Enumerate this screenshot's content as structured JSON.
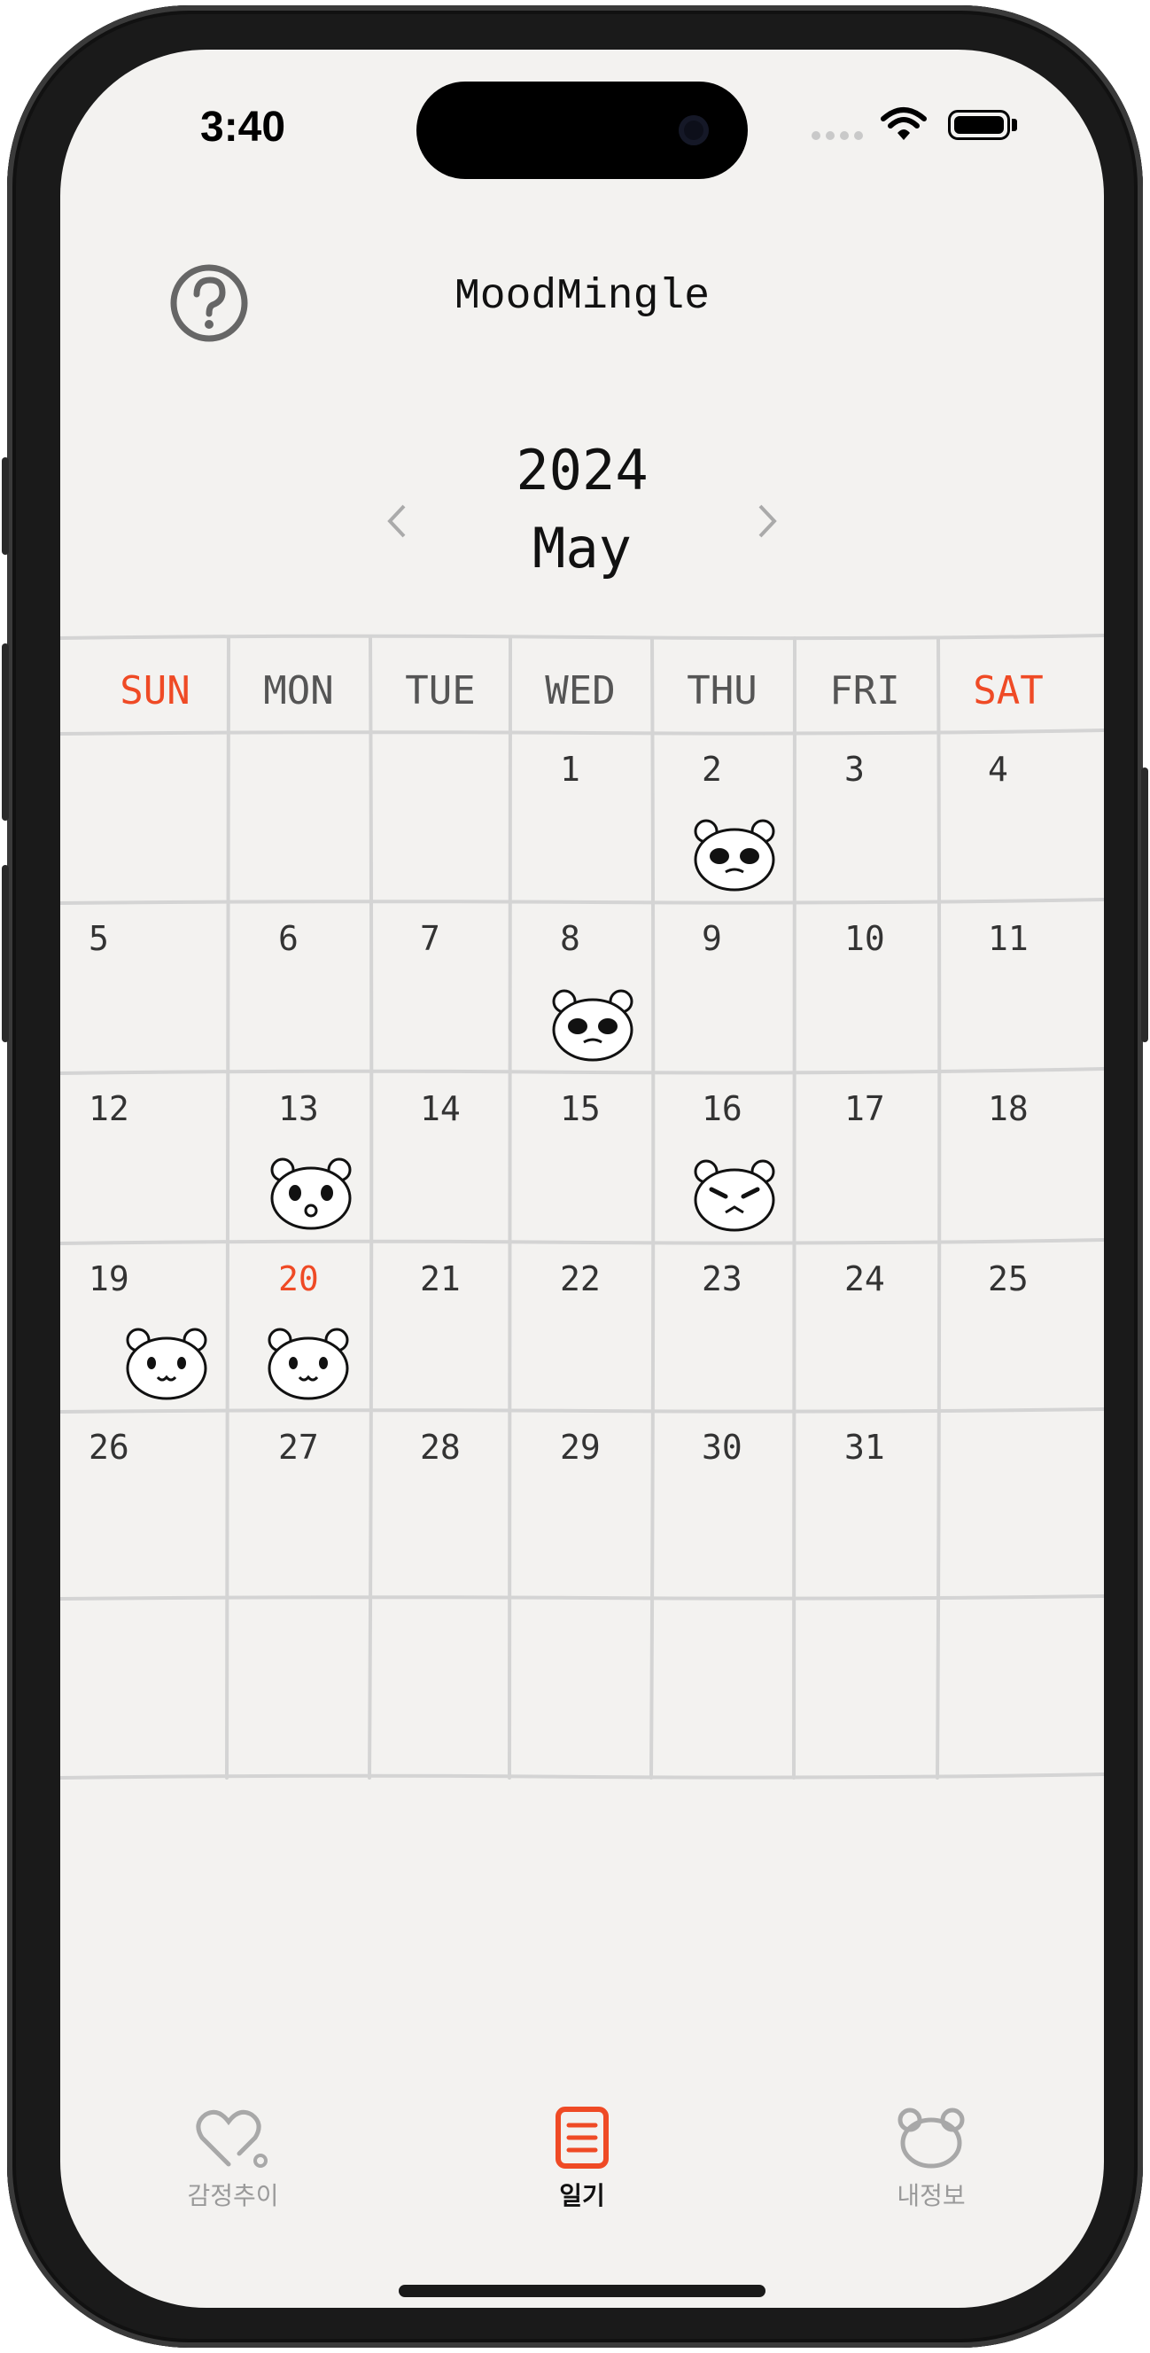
{
  "status": {
    "time": "3:40"
  },
  "header": {
    "title": "MoodMingle"
  },
  "calendar": {
    "year": "2024",
    "month": "May",
    "weekdays": [
      "SUN",
      "MON",
      "TUE",
      "WED",
      "THU",
      "FRI",
      "SAT"
    ],
    "weeks": [
      [
        "",
        "",
        "",
        "1",
        "2",
        "3",
        "4"
      ],
      [
        "5",
        "6",
        "7",
        "8",
        "9",
        "10",
        "11"
      ],
      [
        "12",
        "13",
        "14",
        "15",
        "16",
        "17",
        "18"
      ],
      [
        "19",
        "20",
        "21",
        "22",
        "23",
        "24",
        "25"
      ],
      [
        "26",
        "27",
        "28",
        "29",
        "30",
        "31",
        ""
      ],
      [
        "",
        "",
        "",
        "",
        "",
        "",
        ""
      ]
    ],
    "today": "20",
    "mood_entries": [
      {
        "day": "2",
        "mood": "crying-bear"
      },
      {
        "day": "8",
        "mood": "crying-bear"
      },
      {
        "day": "13",
        "mood": "surprised-bear"
      },
      {
        "day": "16",
        "mood": "angry-bear"
      },
      {
        "day": "19",
        "mood": "happy-bear"
      },
      {
        "day": "20",
        "mood": "happy-bear"
      }
    ]
  },
  "tabs": [
    {
      "label": "감정추이",
      "icon": "heart-icon",
      "active": false
    },
    {
      "label": "일기",
      "icon": "diary-icon",
      "active": true
    },
    {
      "label": "내정보",
      "icon": "bear-profile-icon",
      "active": false
    }
  ],
  "colors": {
    "accent": "#ef4a25",
    "text": "#333333",
    "inactive": "#9a9a9a",
    "grid": "#d6d6d6"
  }
}
